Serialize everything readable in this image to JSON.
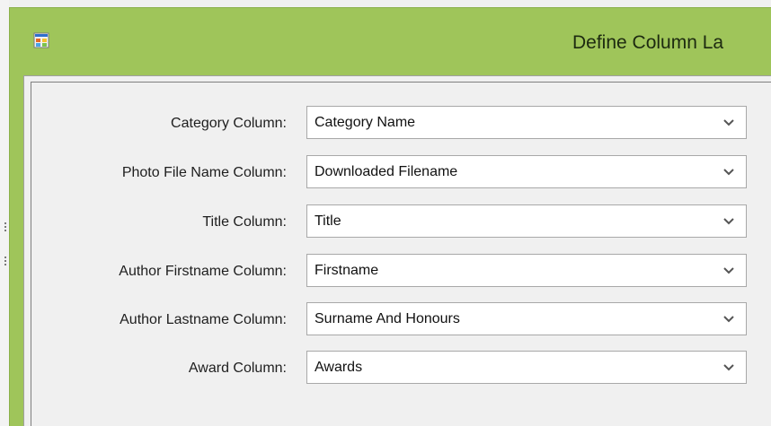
{
  "window": {
    "title": "Define Column La",
    "icon": "form-app-icon"
  },
  "form": {
    "fields": [
      {
        "label": "Category Column:",
        "value": "Category Name"
      },
      {
        "label": "Photo File Name Column:",
        "value": "Downloaded Filename"
      },
      {
        "label": "Title Column:",
        "value": "Title"
      },
      {
        "label": "Author Firstname Column:",
        "value": "Firstname"
      },
      {
        "label": "Author Lastname Column:",
        "value": "Surname And Honours"
      },
      {
        "label": "Award Column:",
        "value": "Awards"
      }
    ]
  },
  "colors": {
    "title_bar": "#9fc55a",
    "client_background": "#f0f0f0",
    "combo_background": "#ffffff",
    "combo_border": "#a8a8a8"
  }
}
